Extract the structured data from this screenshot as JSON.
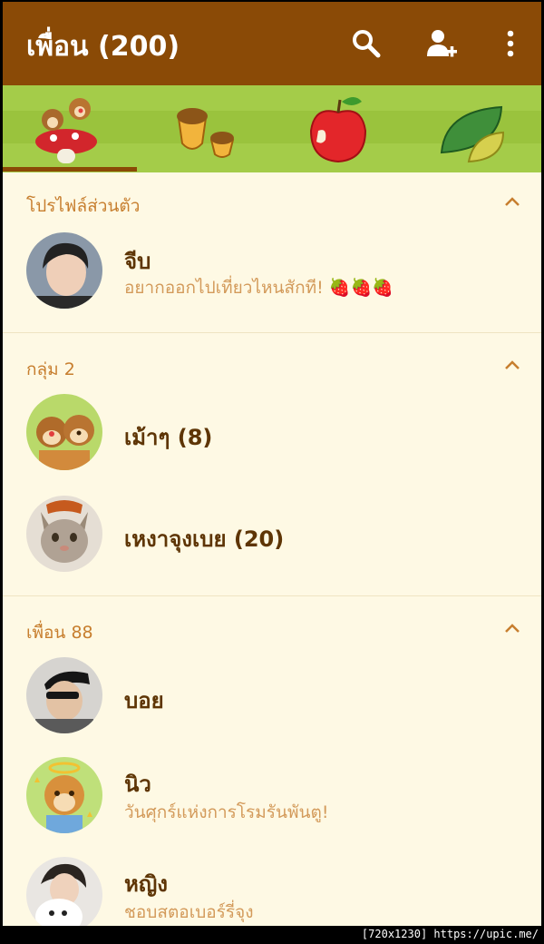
{
  "header": {
    "title": "เพื่อน (200)"
  },
  "icons": {
    "search": "search-icon",
    "add_user": "add-user-icon",
    "more": "more-vert-icon"
  },
  "colors": {
    "appbar": "#8a4a06",
    "background": "#fef9e4",
    "section": "#c77e2e",
    "name": "#5e3505",
    "status": "#d39a5a",
    "tabs": "#a4cc49"
  },
  "tabs": [
    {
      "icon": "chipmunks-icon",
      "selected": true
    },
    {
      "icon": "acorn-icon",
      "selected": false
    },
    {
      "icon": "apple-icon",
      "selected": false
    },
    {
      "icon": "leaf-icon",
      "selected": false
    }
  ],
  "sections": {
    "profile": {
      "label": "โปรไฟล์ส่วนตัว",
      "items": [
        {
          "name": "จีบ",
          "status": "อยากออกไปเที่ยวไหนสักที! 🍓🍓🍓"
        }
      ]
    },
    "groups": {
      "label": "กลุ่ม 2",
      "items": [
        {
          "name": "เม้าๆ (8)"
        },
        {
          "name": "เหงาจุงเบย (20)"
        }
      ]
    },
    "friends": {
      "label": "เพื่อน 88",
      "items": [
        {
          "name": "บอย"
        },
        {
          "name": "นิว",
          "status": "วันศุกร์แห่งการโรมรันพันตู!"
        },
        {
          "name": "หญิง",
          "status": "ชอบสตอเบอร์รี่จุง"
        }
      ]
    }
  },
  "watermark": "[720x1230] https://upic.me/"
}
